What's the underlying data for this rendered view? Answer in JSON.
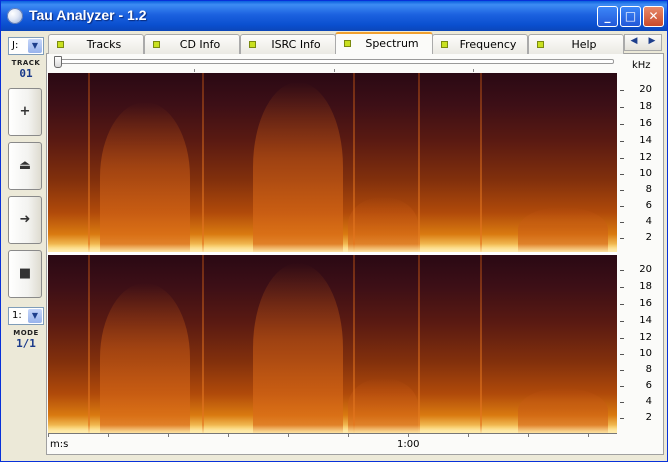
{
  "window": {
    "title": "Tau Analyzer - 1.2",
    "buttons": {
      "minimize": "_",
      "maximize": "□",
      "close": "✕"
    }
  },
  "left_panel": {
    "drive_select": "J:",
    "track_label": "TRACK",
    "track_value": "01",
    "buttons": [
      "+",
      "⏏",
      "➜",
      "■"
    ],
    "mode_select": "1:",
    "mode_label": "MODE",
    "mode_value": "1/1"
  },
  "tabs": [
    {
      "label": "Tracks",
      "active": false
    },
    {
      "label": "CD Info",
      "active": false
    },
    {
      "label": "ISRC Info",
      "active": false
    },
    {
      "label": "Spectrum",
      "active": true
    },
    {
      "label": "Frequency",
      "active": false
    },
    {
      "label": "Help",
      "active": false
    }
  ],
  "tab_nav": {
    "left": "◀",
    "right": "▶"
  },
  "spectrum": {
    "unit_label": "kHz",
    "y_ticks": [
      "20",
      "18",
      "16",
      "14",
      "12",
      "10",
      "8",
      "6",
      "4",
      "2"
    ],
    "x_axis_label": "m:s",
    "x_tick_label": "1:00"
  },
  "colors": {
    "title_bar": "#1c62e0",
    "accent": "#f0a030",
    "spectrum_hot": "#f7c862",
    "spectrum_cold": "#2a0914"
  },
  "icons": {
    "app": "cd-disc-icon"
  }
}
